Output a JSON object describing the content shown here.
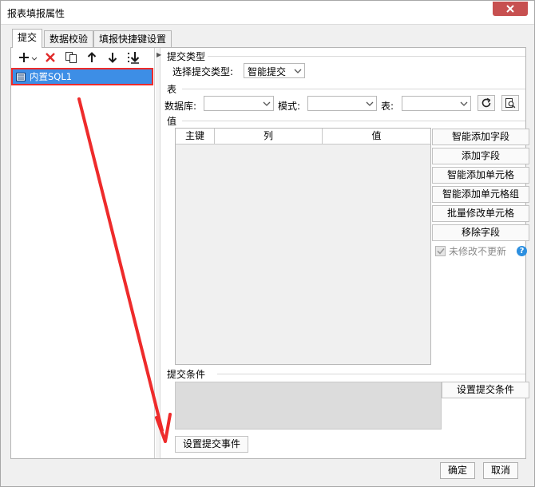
{
  "window": {
    "title": "报表填报属性"
  },
  "tabs": [
    {
      "label": "提交"
    },
    {
      "label": "数据校验"
    },
    {
      "label": "填报快捷键设置"
    }
  ],
  "left": {
    "toolbar_icons": [
      "add-icon",
      "delete-icon",
      "copy-icon",
      "move-up-icon",
      "move-down-icon",
      "move-bottom-icon"
    ],
    "items": [
      {
        "label": "内置SQL1"
      }
    ]
  },
  "submit_type": {
    "section": "提交类型",
    "label": "选择提交类型:",
    "value": "智能提交"
  },
  "table_section": {
    "section": "表",
    "db_label": "数据库:",
    "schema_label": "模式:",
    "table_label": "表:"
  },
  "value_section": {
    "section": "值",
    "columns": [
      "主键",
      "列",
      "值"
    ],
    "buttons": [
      "智能添加字段",
      "添加字段",
      "智能添加单元格",
      "智能添加单元格组",
      "批量修改单元格",
      "移除字段"
    ],
    "checkbox_label": "未修改不更新",
    "checkbox_checked": true
  },
  "condition_section": {
    "section": "提交条件",
    "button": "设置提交条件"
  },
  "event_button": "设置提交事件",
  "footer": {
    "ok": "确定",
    "cancel": "取消"
  },
  "colors": {
    "accent": "#3d8ee6",
    "annotation": "#ee2b2b",
    "help": "#2c8fe0",
    "close": "#c75050"
  }
}
